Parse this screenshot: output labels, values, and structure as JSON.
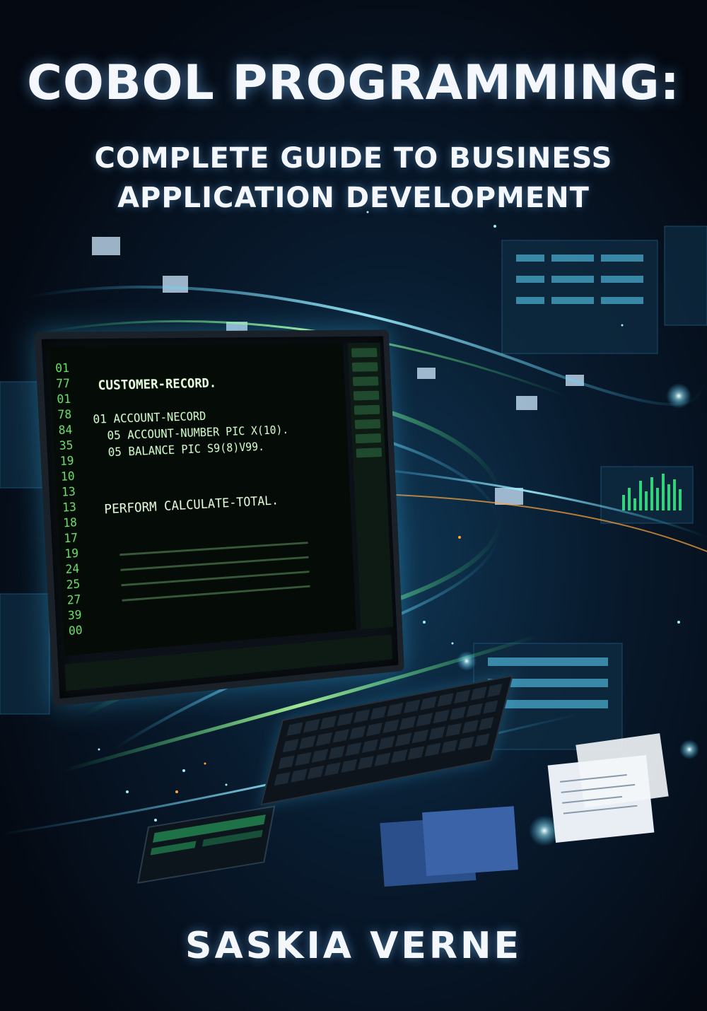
{
  "book": {
    "title": "COBOL PROGRAMMING:",
    "subtitle_line1": "COMPLETE GUIDE TO BUSINESS",
    "subtitle_line2": "APPLICATION DEVELOPMENT",
    "author": "SASKIA VERNE"
  },
  "screen": {
    "header": "CUSTOMER-RECORD.",
    "code_lines": [
      "01 ACCOUNT-NECORD",
      "05 ACCOUNT-NUMBER PIC X(10).",
      "05 BALANCE PIC S9(8)V99.",
      "PERFORM CALCULATE-TOTAL."
    ],
    "line_numbers": [
      "01",
      "77",
      "01",
      "78",
      "84",
      "35",
      "19",
      "10",
      "13",
      "13",
      "18",
      "17",
      "19",
      "24",
      "25",
      "27",
      "39",
      "00"
    ]
  },
  "colors": {
    "title": "#f4f7fb",
    "code_green": "#6fe06a",
    "glow_blue": "#3cc8ff",
    "glow_green": "#3cff8a",
    "glow_orange": "#ffa63c"
  }
}
